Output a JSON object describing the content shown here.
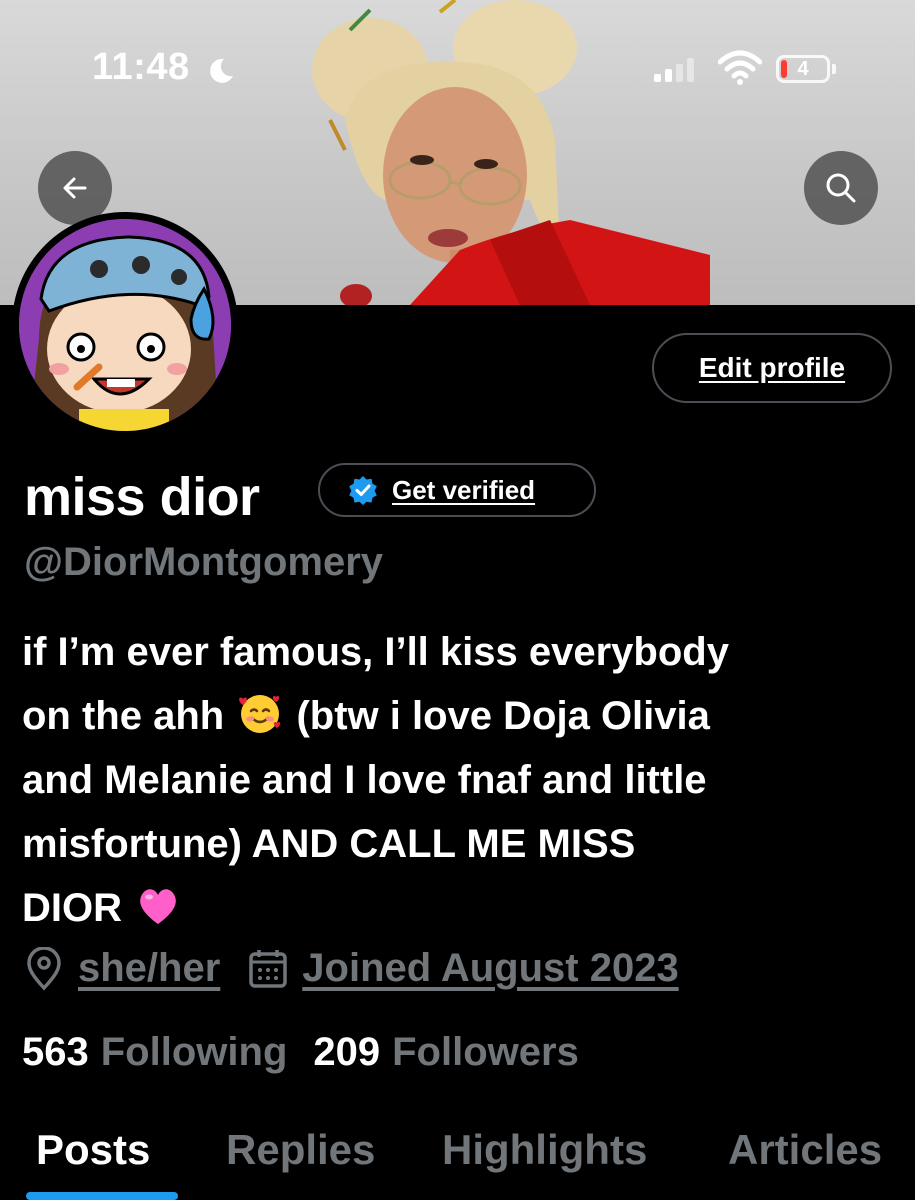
{
  "status_bar": {
    "time": "11:48",
    "battery_level": "4",
    "icons": [
      "moon-icon",
      "signal-icon",
      "wifi-icon",
      "battery-icon"
    ]
  },
  "header": {
    "back_icon": "arrow-left-icon",
    "search_icon": "search-icon"
  },
  "profile": {
    "edit_label": "Edit profile",
    "display_name": "miss dior",
    "verify_label": "Get verified",
    "handle": "@DiorMontgomery",
    "bio_line1": "if I’m ever famous, I’ll kiss everybody",
    "bio_line2_a": "on the ahh",
    "bio_line2_b": "(btw i love Doja Olivia",
    "bio_line3": "and Melanie and I love fnaf and little",
    "bio_line4": "misfortune) AND CALL ME MISS",
    "bio_line5": "DIOR",
    "pronouns": "she/her",
    "joined": "Joined August 2023"
  },
  "stats": {
    "following_count": "563",
    "following_label": "Following",
    "followers_count": "209",
    "followers_label": "Followers"
  },
  "tabs": [
    {
      "label": "Posts",
      "active": true
    },
    {
      "label": "Replies",
      "active": false
    },
    {
      "label": "Highlights",
      "active": false
    },
    {
      "label": "Articles",
      "active": false
    }
  ],
  "colors": {
    "accent": "#1d9bf0",
    "muted_text": "#71767b",
    "background": "#000000",
    "verified_badge": "#1d9bf0"
  }
}
